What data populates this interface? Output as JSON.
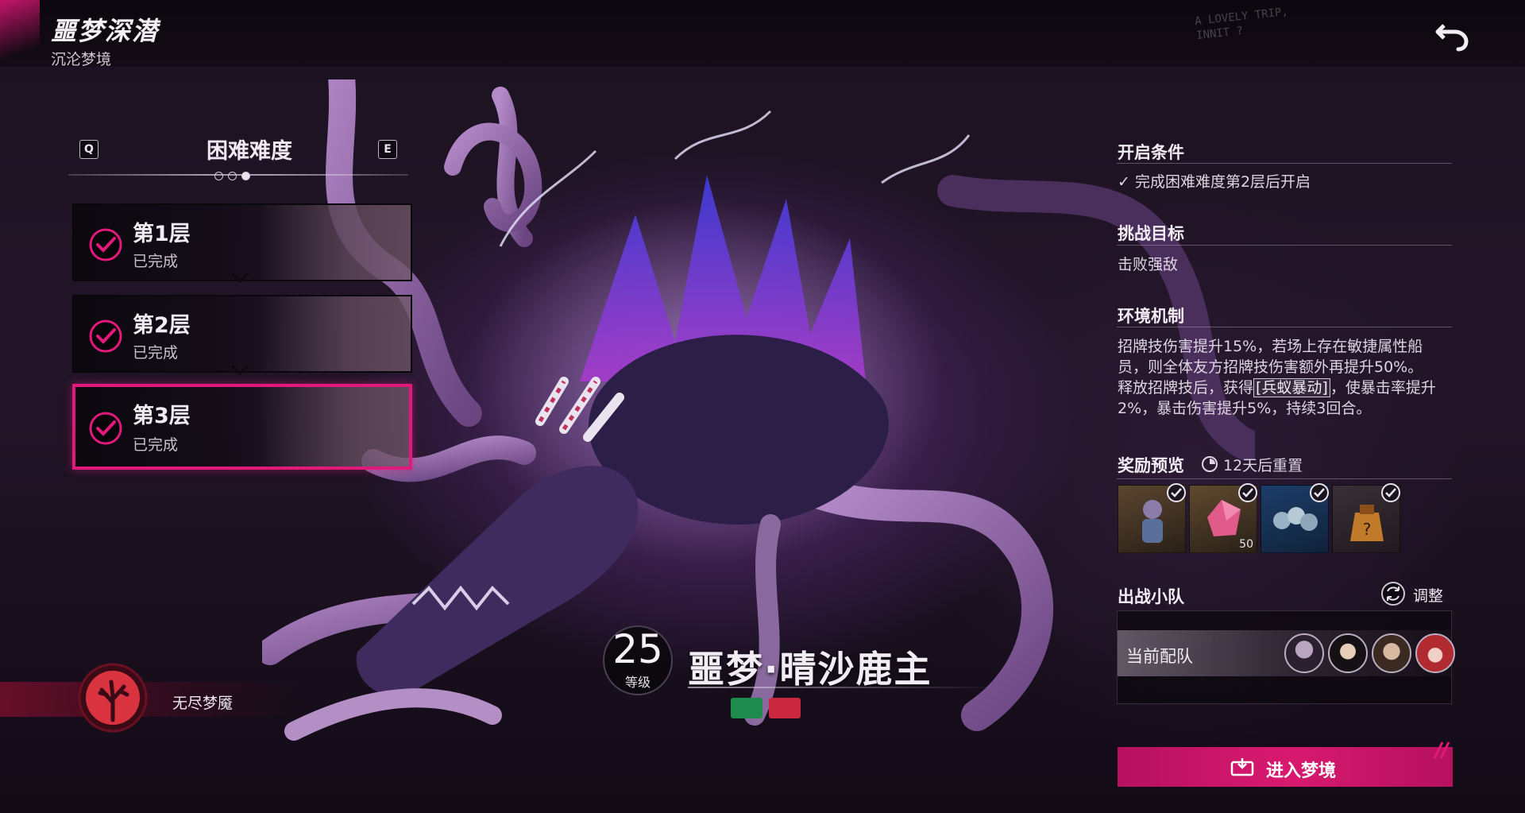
{
  "header": {
    "title": "噩梦深潜",
    "subtitle": "沉沦梦境",
    "back_icon": "return-arrow-icon",
    "scribble_line1": "A LOVELY TRIP,",
    "scribble_line2": "INNIT ?"
  },
  "difficulty": {
    "title": "困难难度",
    "prev_key": "Q",
    "next_key": "E",
    "page_count": 3,
    "current_page": 3,
    "layers": [
      {
        "name": "第1层",
        "status": "已完成",
        "selected": false
      },
      {
        "name": "第2层",
        "status": "已完成",
        "selected": false
      },
      {
        "name": "第3层",
        "status": "已完成",
        "selected": true
      }
    ]
  },
  "endless": {
    "label": "无尽梦魇",
    "icon": "dead-tree-icon"
  },
  "boss": {
    "level": "25",
    "level_label": "等级",
    "name": "噩梦·晴沙鹿主"
  },
  "info": {
    "unlock": {
      "title": "开启条件",
      "check_mark": "✓",
      "condition": "完成困难难度第2层后开启"
    },
    "goal": {
      "title": "挑战目标",
      "text": "击败强敌"
    },
    "mechanism": {
      "title": "环境机制",
      "line1": "招牌技伤害提升15%，若场上存在敏捷属性船员，则全体友方招牌技伤害额外再提升50%。",
      "line2_pre": "释放招牌技后，获得",
      "line2_buff": "[兵蚁暴动]",
      "line2_post": "，使暴击率提升2%，暴击伤害提升5%，持续3回合。"
    },
    "rewards": {
      "title": "奖励预览",
      "reset_note": "12天后重置",
      "items": [
        {
          "icon": "character-figure-icon",
          "qty": "",
          "claimed": true
        },
        {
          "icon": "pink-crystal-icon",
          "qty": "50",
          "claimed": true
        },
        {
          "icon": "blue-orbs-icon",
          "qty": "",
          "claimed": true
        },
        {
          "icon": "mystery-bag-icon",
          "qty": "",
          "claimed": true
        }
      ]
    },
    "team": {
      "title": "出战小队",
      "adjust_label": "调整",
      "current_label": "当前配队"
    },
    "enter_label": "进入梦境"
  },
  "colors": {
    "accent": "#e0197a",
    "button": "#d8196f"
  }
}
